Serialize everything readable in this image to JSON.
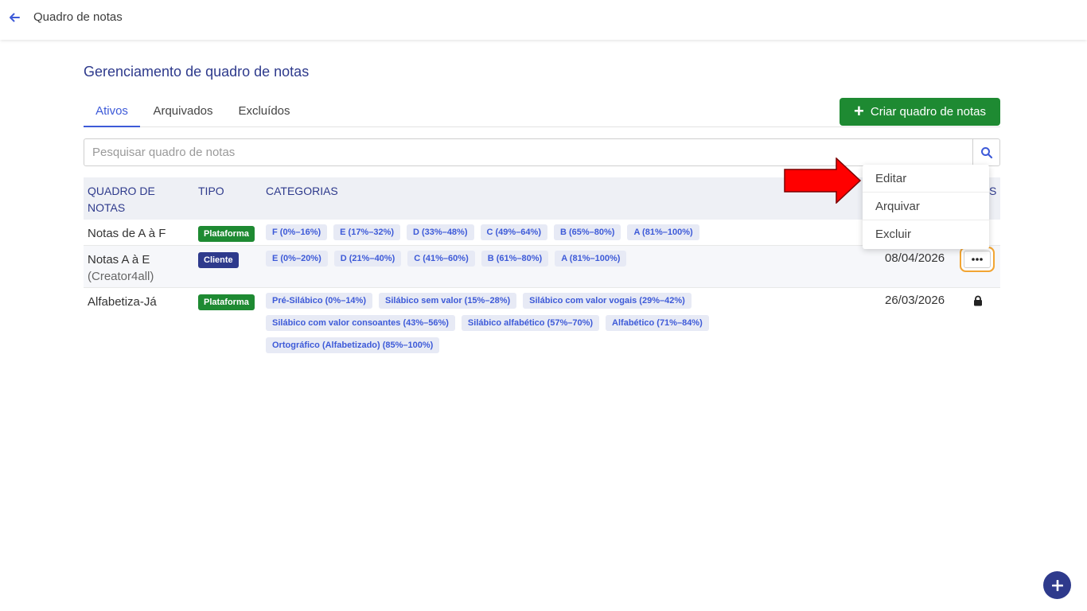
{
  "topbar": {
    "title": "Quadro de notas"
  },
  "page": {
    "title": "Gerenciamento de quadro de notas"
  },
  "tabs": [
    {
      "label": "Ativos",
      "active": true
    },
    {
      "label": "Arquivados",
      "active": false
    },
    {
      "label": "Excluídos",
      "active": false
    }
  ],
  "create_button": {
    "label": "Criar quadro de notas"
  },
  "search": {
    "placeholder": "Pesquisar quadro de notas",
    "value": ""
  },
  "table": {
    "headers": {
      "name": "QUADRO DE NOTAS",
      "type": "TIPO",
      "categories": "CATEGORIAS",
      "actions": "S"
    },
    "rows": [
      {
        "name": "Notas de A à F",
        "subname": "",
        "type": "Plataforma",
        "categories": [
          "F (0%–16%)",
          "E (17%–32%)",
          "D (33%–48%)",
          "C (49%–64%)",
          "B (65%–80%)",
          "A (81%–100%)"
        ],
        "date": ""
      },
      {
        "name": "Notas A à E",
        "subname": "(Creator4all)",
        "type": "Cliente",
        "categories": [
          "E (0%–20%)",
          "D (21%–40%)",
          "C (41%–60%)",
          "B (61%–80%)",
          "A (81%–100%)"
        ],
        "date": "08/04/2026"
      },
      {
        "name": "Alfabetiza-Já",
        "subname": "",
        "type": "Plataforma",
        "categories": [
          "Pré-Silábico (0%–14%)",
          "Silábico sem valor (15%–28%)",
          "Silábico com valor vogais (29%–42%)",
          "Silábico com valor consoantes (43%–56%)",
          "Silábico alfabético (57%–70%)",
          "Alfabético (71%–84%)",
          "Ortográfico (Alfabetizado) (85%–100%)"
        ],
        "date": "26/03/2026"
      }
    ]
  },
  "context_menu": {
    "items": [
      "Editar",
      "Arquivar",
      "Excluir"
    ]
  },
  "colors": {
    "primary": "#2e3a8c",
    "accent": "#3d5ad8",
    "green": "#1e8a32",
    "highlight": "#f2a533",
    "arrow": "#ff0000"
  },
  "icons": {
    "back": "arrow-left-icon",
    "search": "search-icon",
    "more": "ellipsis-icon",
    "lock": "lock-icon",
    "fab": "plus-icon"
  }
}
